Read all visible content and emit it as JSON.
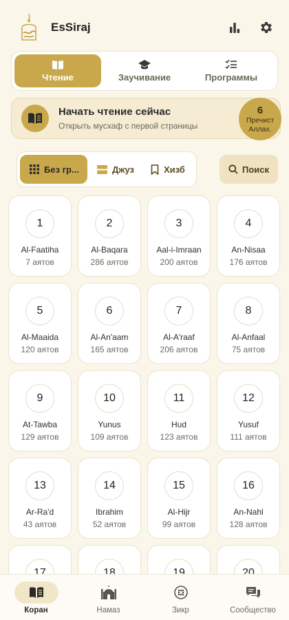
{
  "app": {
    "title": "EsSiraj"
  },
  "modes": [
    {
      "label": "Чтение",
      "icon": "book-open-icon",
      "active": true
    },
    {
      "label": "Заучивание",
      "icon": "graduation-cap-icon",
      "active": false
    },
    {
      "label": "Программы",
      "icon": "checklist-icon",
      "active": false
    }
  ],
  "start": {
    "title": "Начать чтение сейчас",
    "subtitle": "Открыть мусхаф с первой страницы",
    "badge_number": "6",
    "badge_label_1": "Пречист",
    "badge_label_2": "Аллах."
  },
  "grouping": {
    "options": [
      "Без гр...",
      "Джуз",
      "Хизб"
    ],
    "search_label": "Поиск"
  },
  "surahs": [
    {
      "n": "1",
      "name": "Al-Faatiha",
      "ayahs": "7 аятов"
    },
    {
      "n": "2",
      "name": "Al-Baqara",
      "ayahs": "286 аятов"
    },
    {
      "n": "3",
      "name": "Aal-i-Imraan",
      "ayahs": "200 аятов"
    },
    {
      "n": "4",
      "name": "An-Nisaa",
      "ayahs": "176 аятов"
    },
    {
      "n": "5",
      "name": "Al-Maaida",
      "ayahs": "120 аятов"
    },
    {
      "n": "6",
      "name": "Al-An'aam",
      "ayahs": "165 аятов"
    },
    {
      "n": "7",
      "name": "Al-A'raaf",
      "ayahs": "206 аятов"
    },
    {
      "n": "8",
      "name": "Al-Anfaal",
      "ayahs": "75 аятов"
    },
    {
      "n": "9",
      "name": "At-Tawba",
      "ayahs": "129 аятов"
    },
    {
      "n": "10",
      "name": "Yunus",
      "ayahs": "109 аятов"
    },
    {
      "n": "11",
      "name": "Hud",
      "ayahs": "123 аятов"
    },
    {
      "n": "12",
      "name": "Yusuf",
      "ayahs": "111 аятов"
    },
    {
      "n": "13",
      "name": "Ar-Ra'd",
      "ayahs": "43 аятов"
    },
    {
      "n": "14",
      "name": "Ibrahim",
      "ayahs": "52 аятов"
    },
    {
      "n": "15",
      "name": "Al-Hijr",
      "ayahs": "99 аятов"
    },
    {
      "n": "16",
      "name": "An-Nahl",
      "ayahs": "128 аятов"
    },
    {
      "n": "17",
      "name": "",
      "ayahs": ""
    },
    {
      "n": "18",
      "name": "",
      "ayahs": ""
    },
    {
      "n": "19",
      "name": "",
      "ayahs": ""
    },
    {
      "n": "20",
      "name": "",
      "ayahs": ""
    }
  ],
  "bottom_nav": [
    {
      "label": "Коран",
      "icon": "quran-book-icon",
      "active": true
    },
    {
      "label": "Намаз",
      "icon": "mosque-icon",
      "active": false
    },
    {
      "label": "Зикр",
      "icon": "prayer-beads-icon",
      "active": false
    },
    {
      "label": "Сообщество",
      "icon": "chat-bubbles-icon",
      "active": false
    }
  ],
  "colors": {
    "accent": "#c9a84c",
    "background": "#faf6ea",
    "card": "#ffffff"
  }
}
